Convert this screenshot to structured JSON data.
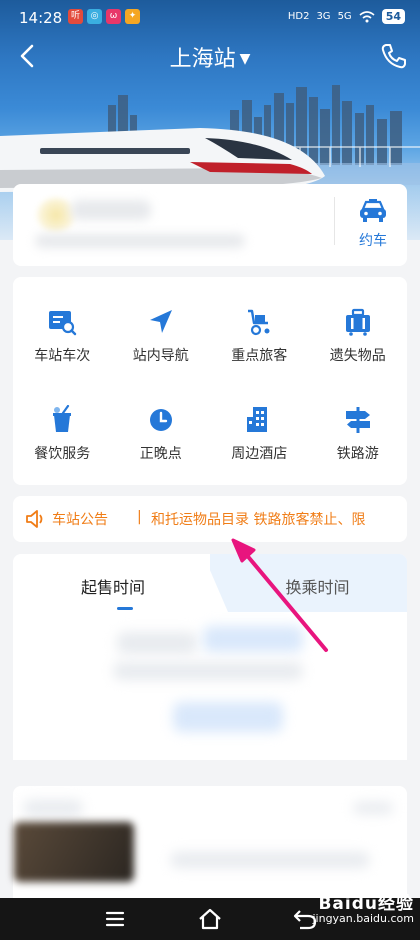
{
  "status_bar": {
    "time": "14:28",
    "signal_labels": [
      "HD2",
      "3G",
      "5G"
    ],
    "battery": "54"
  },
  "header": {
    "title": "上海站"
  },
  "ride": {
    "taxi_label": "约车"
  },
  "menu": {
    "items": [
      {
        "label": "车站车次",
        "icon": "station-trains-icon"
      },
      {
        "label": "站内导航",
        "icon": "navigation-arrow-icon"
      },
      {
        "label": "重点旅客",
        "icon": "wheelchair-icon"
      },
      {
        "label": "遗失物品",
        "icon": "luggage-icon"
      },
      {
        "label": "餐饮服务",
        "icon": "drink-cup-icon"
      },
      {
        "label": "正晚点",
        "icon": "clock-icon"
      },
      {
        "label": "周边酒店",
        "icon": "hotel-building-icon"
      },
      {
        "label": "铁路游",
        "icon": "signpost-icon"
      }
    ]
  },
  "notice": {
    "label": "车站公告",
    "separator": "|",
    "text": "和托运物品目录   铁路旅客禁止、限"
  },
  "tabs": {
    "active": "起售时间",
    "inactive": "换乘时间"
  },
  "watermark": {
    "brand": "Baidu经验",
    "url": "jingyan.baidu.com"
  },
  "colors": {
    "accent": "#2578d8",
    "notice": "#f07d17",
    "annotation_arrow": "#e8157e"
  }
}
